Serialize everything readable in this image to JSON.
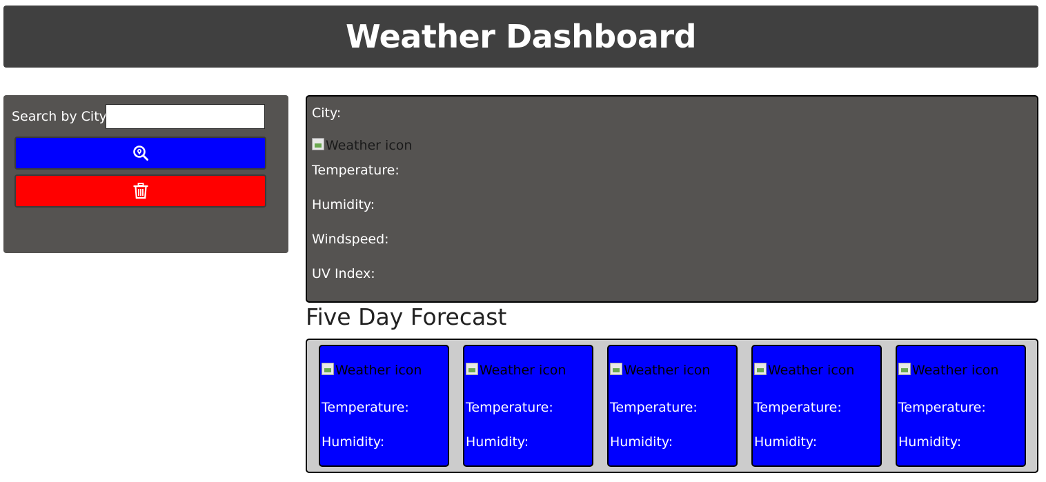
{
  "header": {
    "title": "Weather Dashboard"
  },
  "search": {
    "label": "Search by City:",
    "input_value": "",
    "placeholder": "",
    "search_button_icon": "search-location-icon",
    "clear_button_icon": "trash-icon",
    "colors": {
      "search_button": "#0000ff",
      "clear_button": "#ff0000"
    }
  },
  "current": {
    "city_label": "City:",
    "icon_alt": "Weather icon",
    "temperature_label": "Temperature:",
    "humidity_label": "Humidity:",
    "windspeed_label": "Windspeed:",
    "uv_label": "UV Index:"
  },
  "forecast": {
    "title": "Five Day Forecast",
    "cards": [
      {
        "icon_alt": "Weather icon",
        "temperature_label": "Temperature:",
        "humidity_label": "Humidity:"
      },
      {
        "icon_alt": "Weather icon",
        "temperature_label": "Temperature:",
        "humidity_label": "Humidity:"
      },
      {
        "icon_alt": "Weather icon",
        "temperature_label": "Temperature:",
        "humidity_label": "Humidity:"
      },
      {
        "icon_alt": "Weather icon",
        "temperature_label": "Temperature:",
        "humidity_label": "Humidity:"
      },
      {
        "icon_alt": "Weather icon",
        "temperature_label": "Temperature:",
        "humidity_label": "Humidity:"
      }
    ]
  }
}
